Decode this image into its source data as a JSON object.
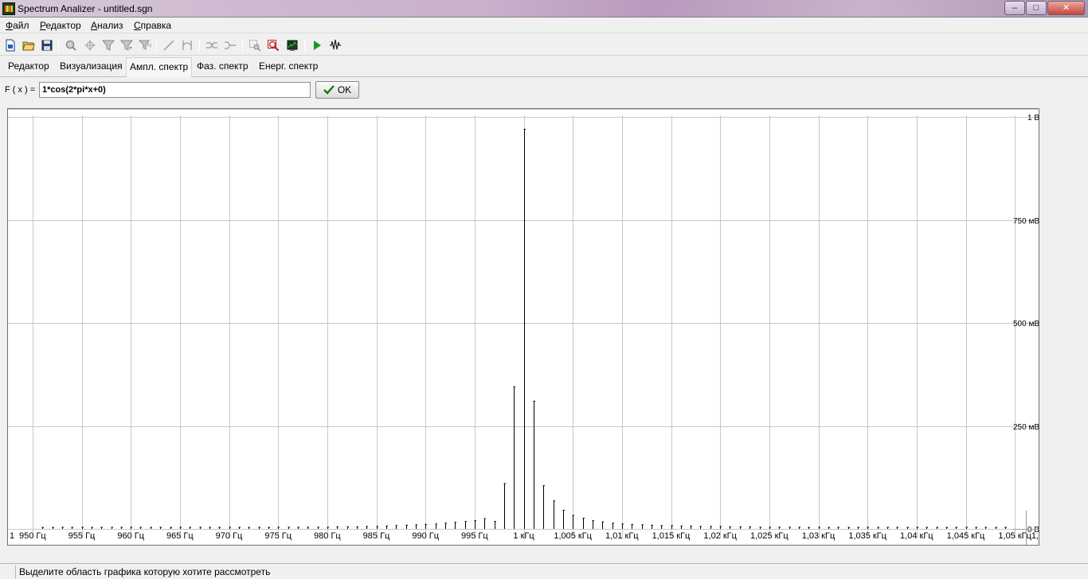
{
  "window": {
    "title": "Spectrum Analizer - untitled.sgn",
    "minimize_glyph": "–",
    "maximize_glyph": "□",
    "close_glyph": "✕"
  },
  "menu": [
    {
      "label": "Файл"
    },
    {
      "label": "Редактор"
    },
    {
      "label": "Анализ"
    },
    {
      "label": "Справка"
    }
  ],
  "toolbar": {
    "icons": [
      "new-file-icon",
      "open-folder-icon",
      "save-disk-icon",
      "zoom-icon",
      "crosshair-icon",
      "filter-icon",
      "filter-down-icon",
      "filter-xy-icon",
      "line-icon",
      "bracket-icon",
      "signal-split-icon",
      "signal-merge-icon",
      "select-area-icon",
      "zoom-area-icon",
      "chart-window-icon",
      "play-icon",
      "waveform-icon"
    ],
    "accent_play": "#1a9a1a"
  },
  "tabs": [
    {
      "label": "Редактор",
      "active": false
    },
    {
      "label": "Визуализация",
      "active": false
    },
    {
      "label": "Ампл. спектр",
      "active": true
    },
    {
      "label": "Фаз. спектр",
      "active": false
    },
    {
      "label": "Енерг. спектр",
      "active": false
    }
  ],
  "formula": {
    "label": "F ( x ) =",
    "value": "1*cos(2*pi*x+0)",
    "ok_label": "OK"
  },
  "status": {
    "text": "Выделите область графика которую хотите рассмотреть"
  },
  "chart_data": {
    "type": "bar",
    "xlabel": "",
    "ylabel": "",
    "xlim": [
      947.5,
      1052.5
    ],
    "ylim": [
      0,
      1.0
    ],
    "grid": true,
    "x_ticks": [
      {
        "value": 947.5,
        "label": "1"
      },
      {
        "value": 950,
        "label": "950 Гц"
      },
      {
        "value": 955,
        "label": "955 Гц"
      },
      {
        "value": 960,
        "label": "960 Гц"
      },
      {
        "value": 965,
        "label": "965 Гц"
      },
      {
        "value": 970,
        "label": "970 Гц"
      },
      {
        "value": 975,
        "label": "975 Гц"
      },
      {
        "value": 980,
        "label": "980 Гц"
      },
      {
        "value": 985,
        "label": "985 Гц"
      },
      {
        "value": 990,
        "label": "990 Гц"
      },
      {
        "value": 995,
        "label": "995 Гц"
      },
      {
        "value": 1000,
        "label": "1 кГц"
      },
      {
        "value": 1005,
        "label": "1,005 кГц"
      },
      {
        "value": 1010,
        "label": "1,01 кГц"
      },
      {
        "value": 1015,
        "label": "1,015 кГц"
      },
      {
        "value": 1020,
        "label": "1,02 кГц"
      },
      {
        "value": 1025,
        "label": "1,025 кГц"
      },
      {
        "value": 1030,
        "label": "1,03 кГц"
      },
      {
        "value": 1035,
        "label": "1,035 кГц"
      },
      {
        "value": 1040,
        "label": "1,04 кГц"
      },
      {
        "value": 1045,
        "label": "1,045 кГц"
      },
      {
        "value": 1050,
        "label": "1,05 кГц"
      },
      {
        "value": 1052.5,
        "label": "1,"
      }
    ],
    "y_ticks": [
      {
        "value": 1.0,
        "label": "1 В"
      },
      {
        "value": 0.75,
        "label": "750 мВ"
      },
      {
        "value": 0.5,
        "label": "500 мВ"
      },
      {
        "value": 0.25,
        "label": "250 мВ"
      },
      {
        "value": 0,
        "label": "0 В"
      }
    ],
    "x": [
      951,
      952,
      953,
      954,
      955,
      956,
      957,
      958,
      959,
      960,
      961,
      962,
      963,
      964,
      965,
      966,
      967,
      968,
      969,
      970,
      971,
      972,
      973,
      974,
      975,
      976,
      977,
      978,
      979,
      980,
      981,
      982,
      983,
      984,
      985,
      986,
      987,
      988,
      989,
      990,
      991,
      992,
      993,
      994,
      995,
      996,
      997,
      998,
      999,
      1000,
      1001,
      1002,
      1003,
      1004,
      1005,
      1006,
      1007,
      1008,
      1009,
      1010,
      1011,
      1012,
      1013,
      1014,
      1015,
      1016,
      1017,
      1018,
      1019,
      1020,
      1021,
      1022,
      1023,
      1024,
      1025,
      1026,
      1027,
      1028,
      1029,
      1030,
      1031,
      1032,
      1033,
      1034,
      1035,
      1036,
      1037,
      1038,
      1039,
      1040,
      1041,
      1042,
      1043,
      1044,
      1045,
      1046,
      1047,
      1048,
      1049
    ],
    "values": [
      0.002,
      0.002,
      0.002,
      0.002,
      0.002,
      0.002,
      0.002,
      0.002,
      0.002,
      0.002,
      0.002,
      0.002,
      0.002,
      0.002,
      0.002,
      0.003,
      0.003,
      0.003,
      0.003,
      0.003,
      0.003,
      0.003,
      0.003,
      0.003,
      0.003,
      0.004,
      0.004,
      0.004,
      0.004,
      0.004,
      0.005,
      0.005,
      0.005,
      0.006,
      0.006,
      0.007,
      0.008,
      0.009,
      0.01,
      0.011,
      0.012,
      0.014,
      0.016,
      0.018,
      0.02,
      0.025,
      0.018,
      0.11,
      0.345,
      0.97,
      0.31,
      0.105,
      0.068,
      0.045,
      0.033,
      0.026,
      0.02,
      0.017,
      0.014,
      0.012,
      0.011,
      0.01,
      0.009,
      0.008,
      0.008,
      0.007,
      0.007,
      0.006,
      0.006,
      0.006,
      0.005,
      0.005,
      0.005,
      0.004,
      0.004,
      0.004,
      0.004,
      0.004,
      0.003,
      0.003,
      0.003,
      0.003,
      0.003,
      0.003,
      0.003,
      0.003,
      0.003,
      0.002,
      0.002,
      0.002,
      0.002,
      0.002,
      0.002,
      0.002,
      0.002,
      0.002,
      0.002,
      0.002,
      0.002
    ]
  }
}
